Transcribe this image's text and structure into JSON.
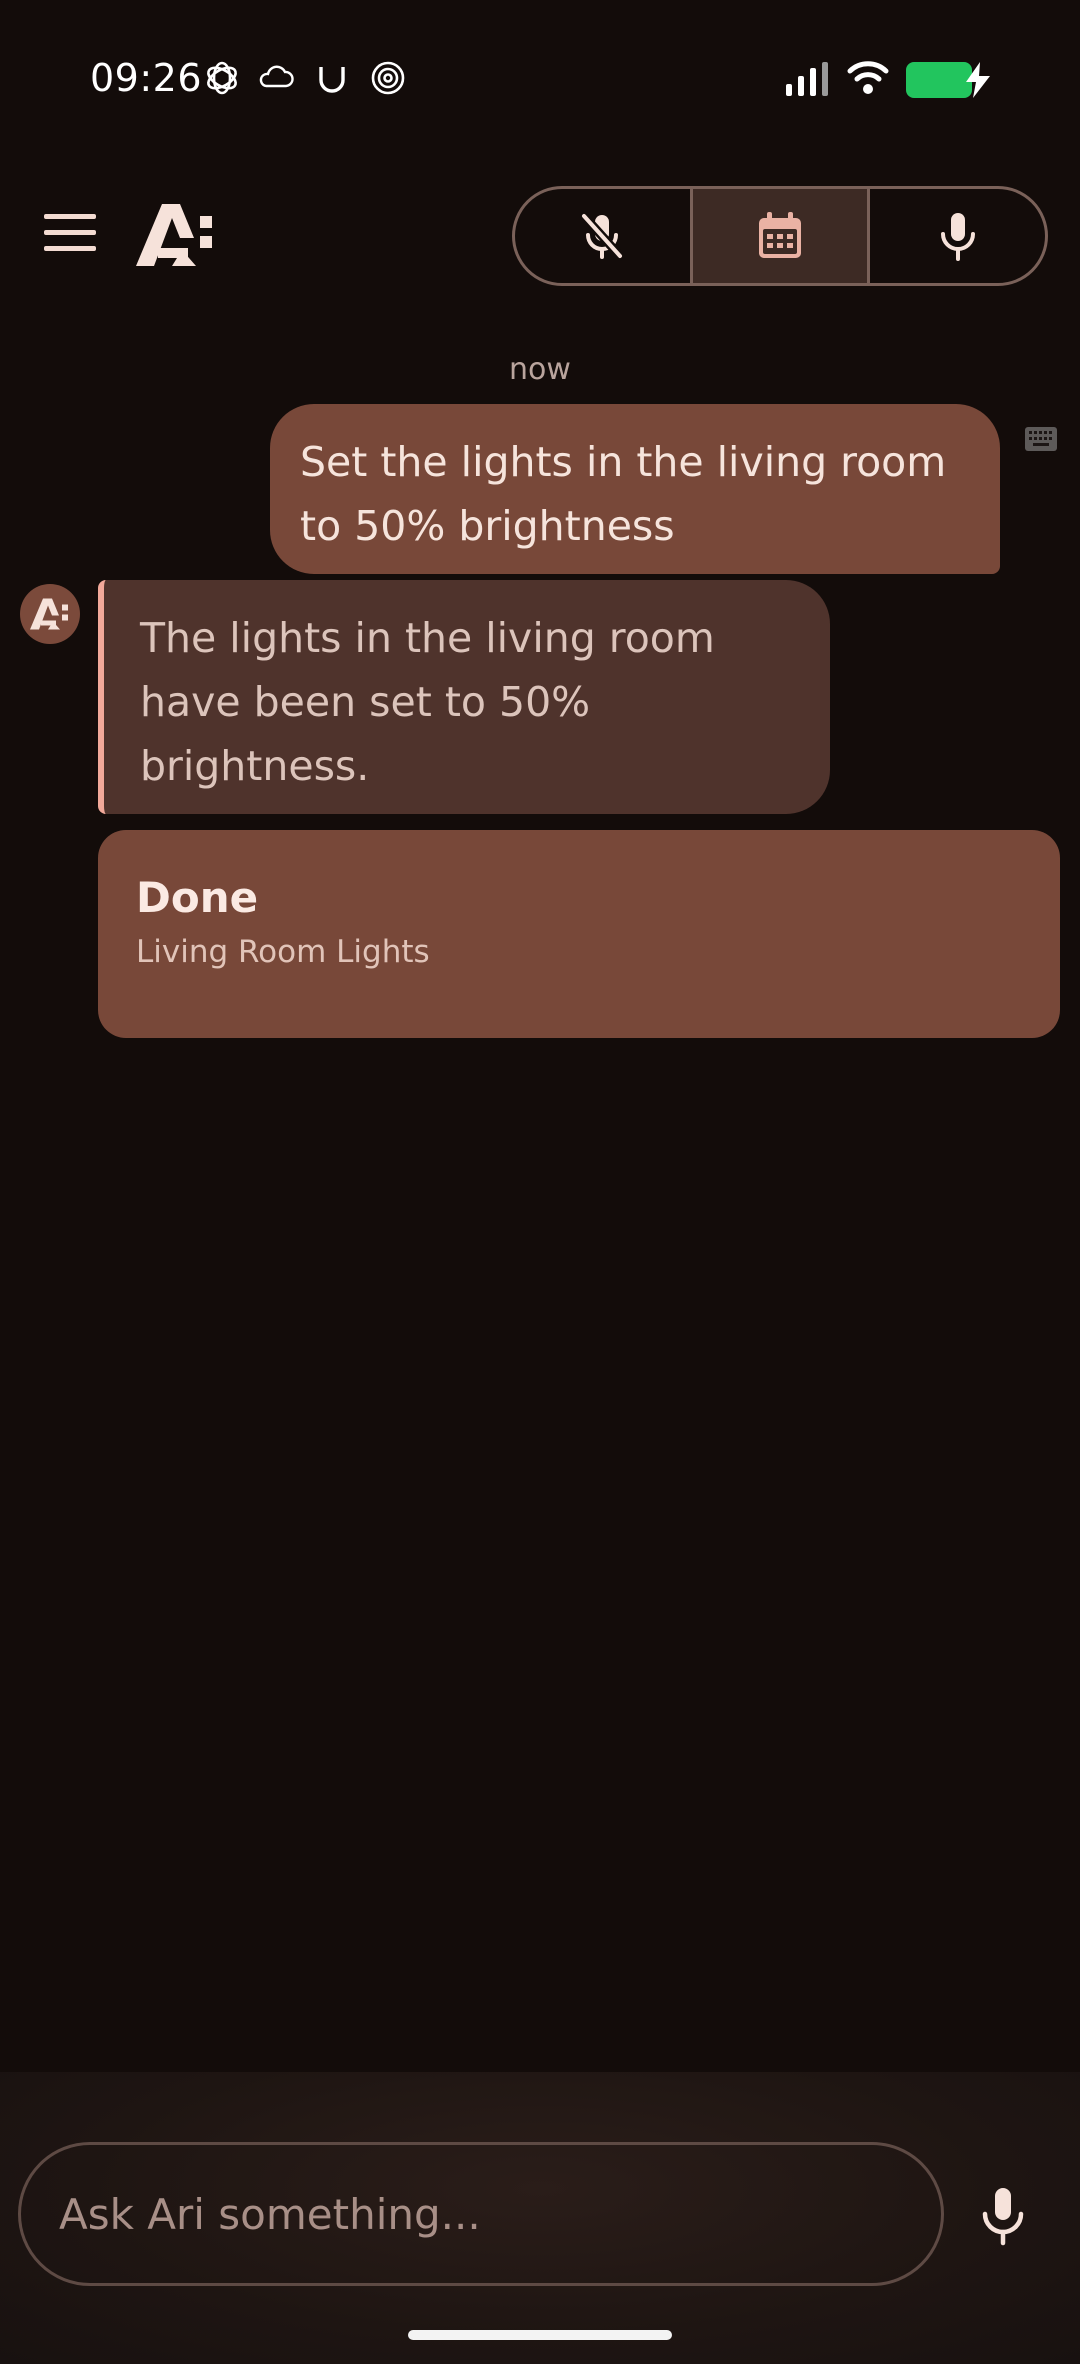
{
  "status_bar": {
    "time": "09:26",
    "notification_icons": [
      "openai-icon",
      "cloud-icon",
      "u-logo-icon",
      "spiral-icon"
    ],
    "signal_icon": "signal-icon",
    "wifi_icon": "wifi-icon",
    "battery_color": "#22c55e",
    "battery_state": "charging"
  },
  "header": {
    "menu_icon": "hamburger-menu-icon",
    "logo_icon": "ari-logo-icon",
    "modes": [
      {
        "icon": "mic-off-icon",
        "active": false
      },
      {
        "icon": "calendar-icon",
        "active": true
      },
      {
        "icon": "mic-icon",
        "active": false
      }
    ]
  },
  "chat": {
    "timestamp": "now",
    "messages": [
      {
        "role": "user",
        "text": "Set the lights in the living room to 50% brightness",
        "input_icon": "keyboard-icon"
      },
      {
        "role": "assistant",
        "text": "The lights in the living room have been set to 50% brightness."
      }
    ],
    "result_card": {
      "title": "Done",
      "subtitle": "Living Room Lights"
    }
  },
  "input": {
    "placeholder": "Ask Ari something..."
  },
  "colors": {
    "background": "#130c0a",
    "user_bubble": "#784839",
    "assistant_bubble": "#4f332c",
    "accent": "#f2a99a"
  }
}
